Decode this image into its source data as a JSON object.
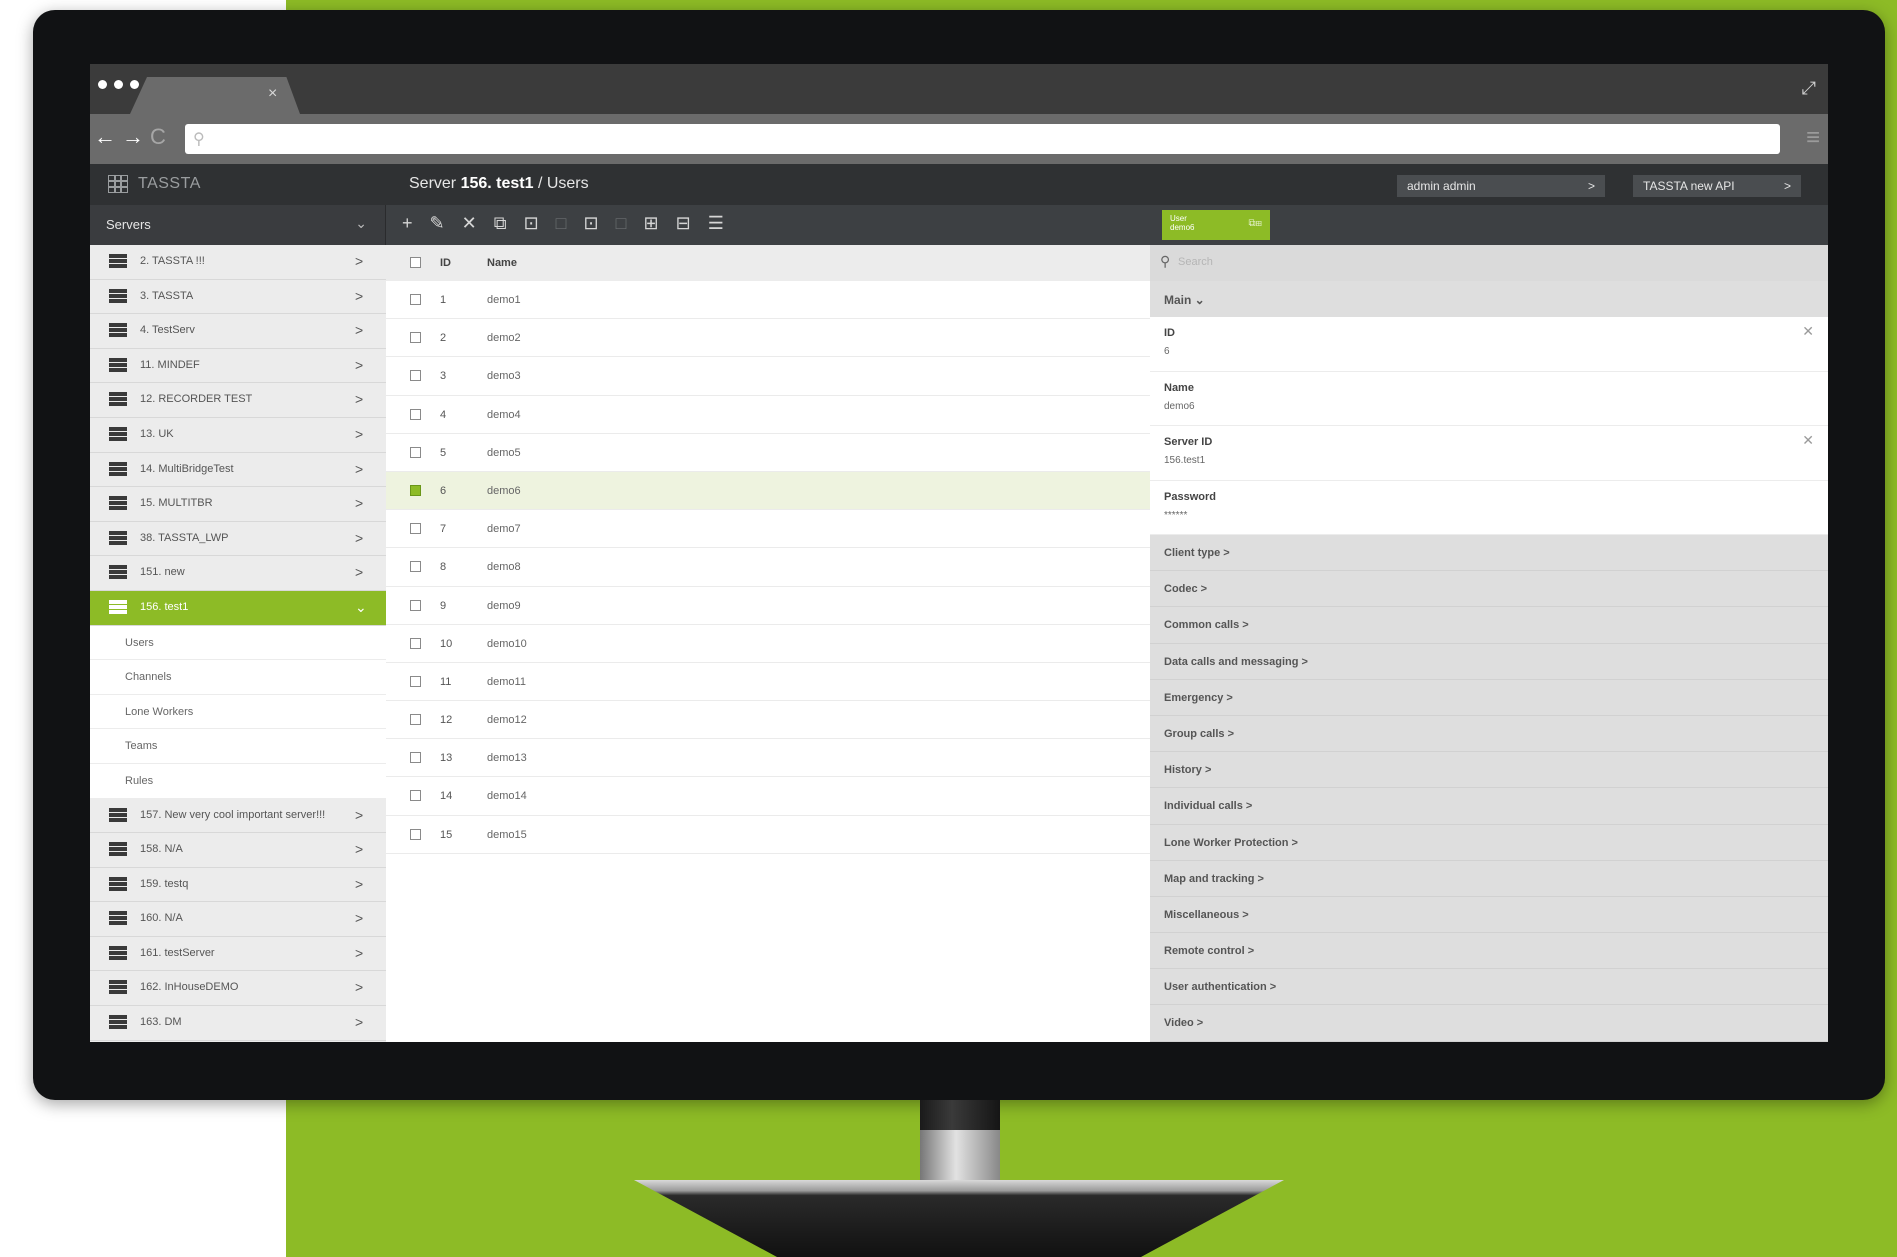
{
  "browser": {
    "tab_close": "×",
    "nav_back": "←",
    "nav_forward": "→",
    "nav_refresh": "C",
    "url_icon": "search-icon",
    "menu_icon": "≡"
  },
  "app": {
    "logo_text": "TASSTA",
    "breadcrumb_prefix": "Server ",
    "breadcrumb_server": "156. test1",
    "breadcrumb_suffix": " / Users",
    "user_button": "admin admin",
    "api_button": "TASSTA new API",
    "chevron": ">"
  },
  "toolbar": {
    "servers_label": "Servers",
    "servers_chevron": "⌄",
    "user_badge_line1": "User",
    "user_badge_line2": "demo6",
    "tools": [
      "+",
      "✎",
      "✕",
      "⧉",
      "⊡",
      "□",
      "⊡",
      "□",
      "⊞",
      "⊟",
      "☰"
    ]
  },
  "sidebar": {
    "servers": [
      {
        "label": "2. TASSTA !!!",
        "arrow": ">"
      },
      {
        "label": "3. TASSTA",
        "arrow": ">"
      },
      {
        "label": "4. TestServ",
        "arrow": ">"
      },
      {
        "label": "11. MINDEF",
        "arrow": ">"
      },
      {
        "label": "12. RECORDER TEST",
        "arrow": ">"
      },
      {
        "label": "13. UK",
        "arrow": ">"
      },
      {
        "label": "14. MultiBridgeTest",
        "arrow": ">"
      },
      {
        "label": "15. MULTITBR",
        "arrow": ">"
      },
      {
        "label": "38. TASSTA_LWP",
        "arrow": ">"
      },
      {
        "label": "151. new",
        "arrow": ">"
      },
      {
        "label": "156. test1",
        "arrow": "⌄"
      }
    ],
    "subitems": [
      "Users",
      "Channels",
      "Lone Workers",
      "Teams",
      "Rules"
    ],
    "servers_after": [
      {
        "label": "157. New very cool important server!!!",
        "arrow": ">"
      },
      {
        "label": "158. N/A",
        "arrow": ">"
      },
      {
        "label": "159. testq",
        "arrow": ">"
      },
      {
        "label": "160. N/A",
        "arrow": ">"
      },
      {
        "label": "161. testServer",
        "arrow": ">"
      },
      {
        "label": "162. InHouseDEMO",
        "arrow": ">"
      },
      {
        "label": "163. DM",
        "arrow": ">"
      }
    ]
  },
  "users_table": {
    "headers": {
      "id": "ID",
      "name": "Name"
    },
    "rows": [
      {
        "id": "1",
        "name": "demo1"
      },
      {
        "id": "2",
        "name": "demo2"
      },
      {
        "id": "3",
        "name": "demo3"
      },
      {
        "id": "4",
        "name": "demo4"
      },
      {
        "id": "5",
        "name": "demo5"
      },
      {
        "id": "6",
        "name": "demo6",
        "selected": true
      },
      {
        "id": "7",
        "name": "demo7"
      },
      {
        "id": "8",
        "name": "demo8"
      },
      {
        "id": "9",
        "name": "demo9"
      },
      {
        "id": "10",
        "name": "demo10"
      },
      {
        "id": "11",
        "name": "demo11"
      },
      {
        "id": "12",
        "name": "demo12"
      },
      {
        "id": "13",
        "name": "demo13"
      },
      {
        "id": "14",
        "name": "demo14"
      },
      {
        "id": "15",
        "name": "demo15"
      }
    ]
  },
  "detail": {
    "search_placeholder": "Search",
    "main_label": "Main ⌄",
    "fields": [
      {
        "label": "ID",
        "value": "6",
        "clear": "✕"
      },
      {
        "label": "Name",
        "value": "demo6",
        "clear": ""
      },
      {
        "label": "Server ID",
        "value": "156.test1",
        "clear": "✕"
      },
      {
        "label": "Password",
        "value": "******",
        "clear": ""
      }
    ],
    "groups": [
      "Client type >",
      "Codec >",
      "Common calls >",
      "Data calls and messaging >",
      "Emergency >",
      "Group calls >",
      "History >",
      "Individual calls >",
      "Lone Worker Protection >",
      "Map and tracking >",
      "Miscellaneous >",
      "Remote control >",
      "User authentication >",
      "Video >"
    ]
  },
  "colors": {
    "brand_green": "#8dbb26",
    "header_dark": "#2f3133",
    "toolbar_dark": "#3d4043"
  }
}
